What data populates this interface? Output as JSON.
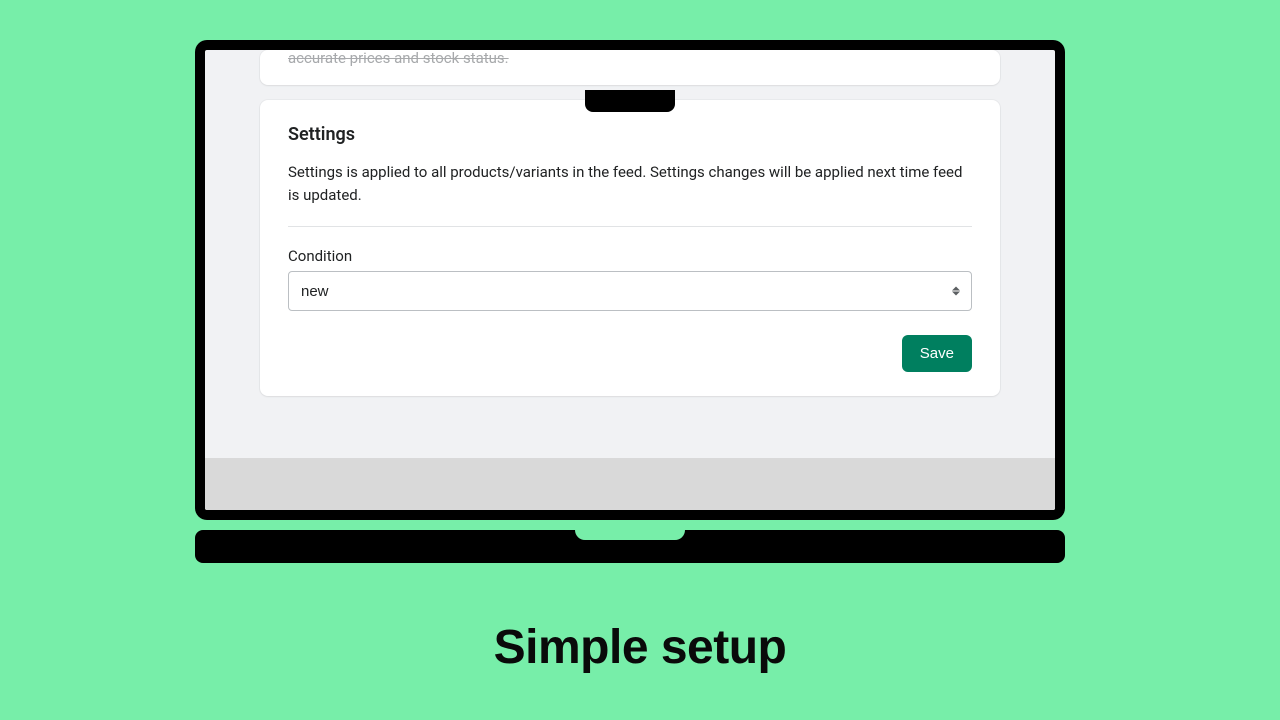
{
  "top_card": {
    "peek_text": "accurate prices and stock status."
  },
  "settings": {
    "title": "Settings",
    "description": "Settings is applied to all products/variants in the feed. Settings changes will be applied next time feed is updated.",
    "condition_label": "Condition",
    "condition_value": "new",
    "save_label": "Save"
  },
  "tagline": "Simple setup"
}
